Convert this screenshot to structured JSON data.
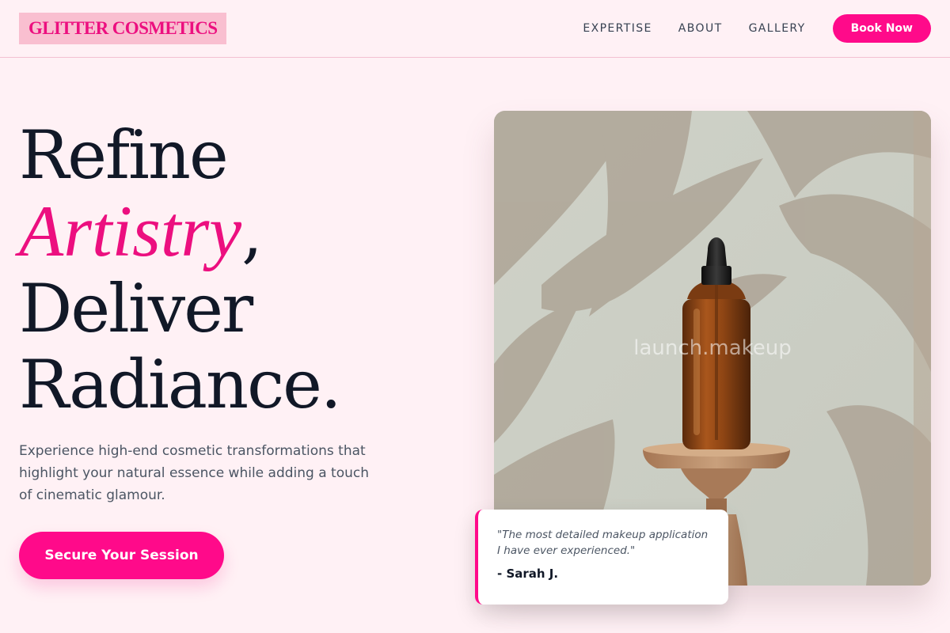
{
  "header": {
    "logo": "GLITTER COSMETICS",
    "nav": [
      {
        "label": "EXPERTISE"
      },
      {
        "label": "ABOUT"
      },
      {
        "label": "GALLERY"
      }
    ],
    "book_label": "Book Now"
  },
  "hero": {
    "line1": "Refine",
    "line2_accent": "Artistry",
    "line2_punct": ",",
    "line3": "Deliver",
    "line4": "Radiance.",
    "subtext": "Experience high-end cosmetic transformations that highlight your natural essence while adding a touch of cinematic glamour.",
    "cta_label": "Secure Your Session"
  },
  "image": {
    "watermark": "launch.makeup",
    "subject_icon": "serum-dropper-bottle"
  },
  "testimonial": {
    "quote": "\"The most detailed makeup application I have ever experienced.\"",
    "author": "- Sarah J."
  },
  "colors": {
    "accent": "#ff0a8a",
    "accent_text": "#ec0f7f",
    "background": "#fff1f5",
    "logo_bg": "#f9bfd0",
    "text_dark": "#111827",
    "text_muted": "#4b5563"
  }
}
